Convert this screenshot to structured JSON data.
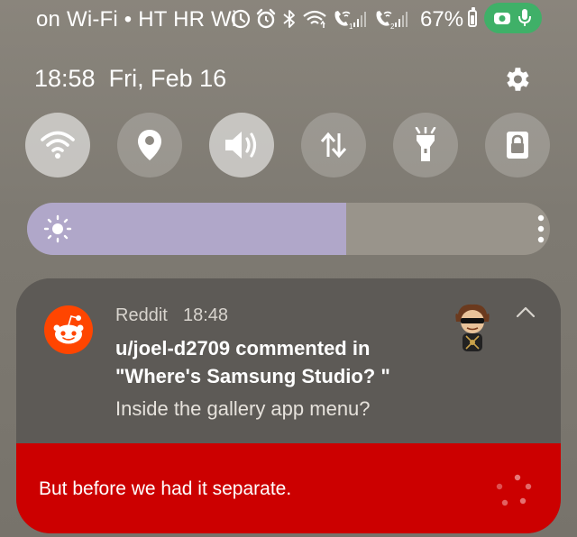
{
  "status_bar": {
    "carrier_text": "on Wi-Fi • HT HR Wi",
    "battery_percent": "67%",
    "battery_level": 0.67,
    "icons": [
      "data-saver-icon",
      "alarm-icon",
      "bluetooth-icon",
      "wifi-data-icon",
      "wifi-call-sim1-icon",
      "signal-icon",
      "wifi-call-sim2-icon",
      "signal-icon",
      "battery-icon",
      "camera-in-use-icon",
      "microphone-in-use-icon"
    ],
    "privacy_indicator_color": "#3fb068"
  },
  "header": {
    "time": "18:58",
    "date": "Fri, Feb 16"
  },
  "quick_settings": [
    {
      "name": "wifi",
      "icon": "wifi-icon",
      "state": "on"
    },
    {
      "name": "location",
      "icon": "location-pin-icon",
      "state": "off"
    },
    {
      "name": "sound",
      "icon": "speaker-icon",
      "state": "on"
    },
    {
      "name": "mobile-data",
      "icon": "data-arrows-icon",
      "state": "off"
    },
    {
      "name": "flashlight",
      "icon": "flashlight-icon",
      "state": "off"
    },
    {
      "name": "lock-screen",
      "icon": "lock-icon",
      "state": "off"
    }
  ],
  "brightness": {
    "level": 0.61,
    "fill_color": "#b0a7c9"
  },
  "notification": {
    "app_name": "Reddit",
    "time": "18:48",
    "title": "u/joel-d2709 commented in \"Where's Samsung Studio? \"",
    "body": "Inside the gallery app menu?",
    "reply_preview": "But before we had it separate.",
    "accent_color": "#ff4500",
    "reply_bg_color": "#cc0000"
  }
}
